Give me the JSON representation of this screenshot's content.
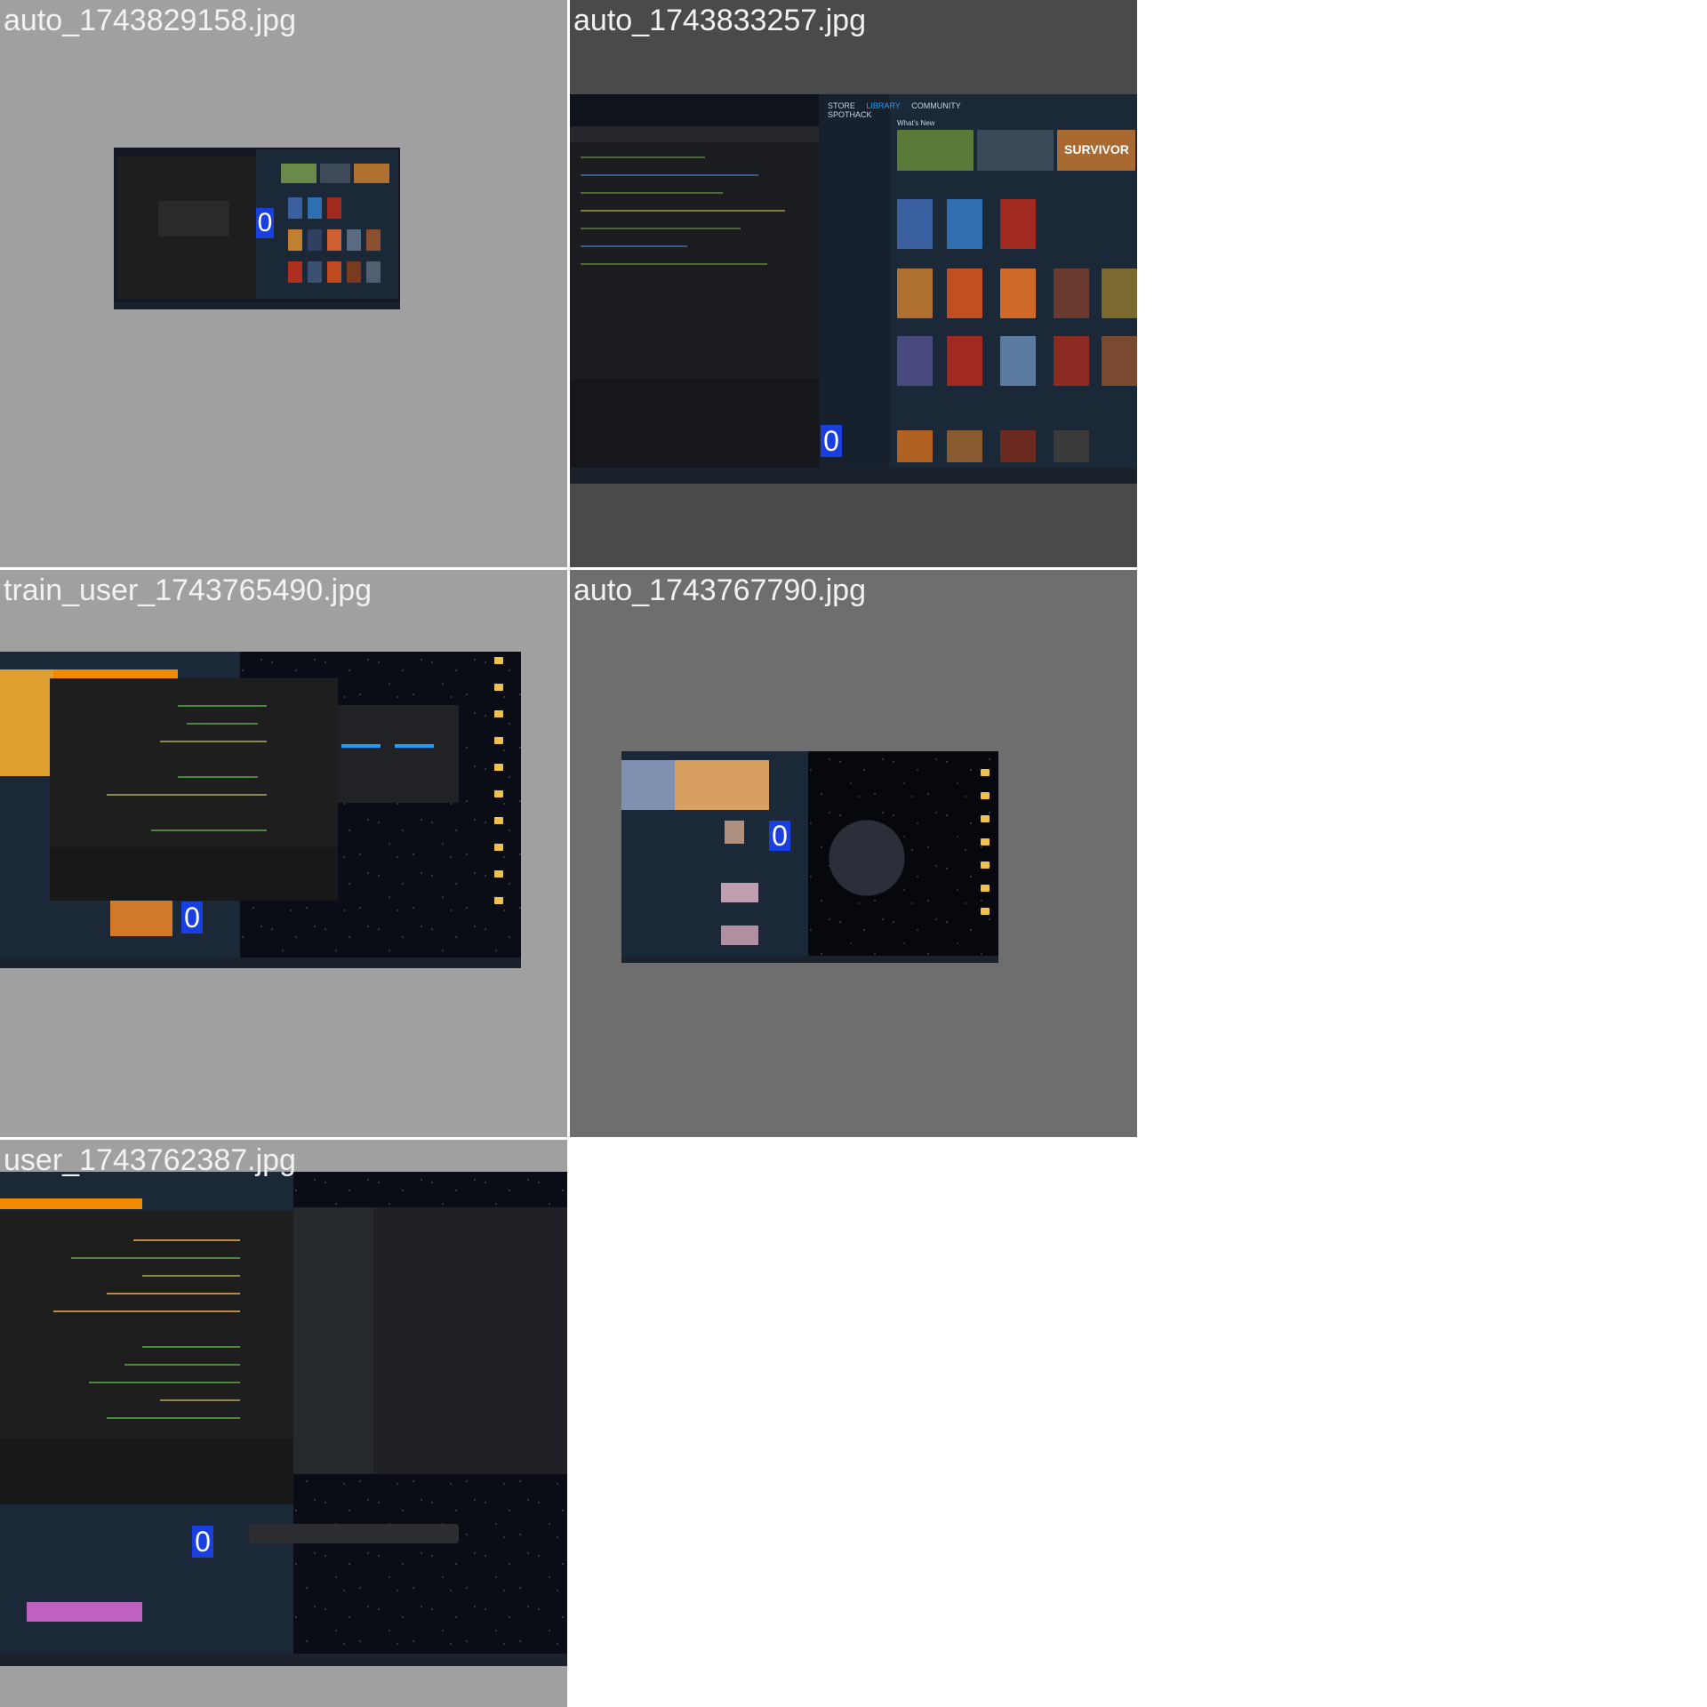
{
  "tiles": [
    {
      "filename": "auto_1743829158.jpg",
      "badge": "0",
      "background": "#a0a0a0"
    },
    {
      "filename": "auto_1743833257.jpg",
      "badge": "0",
      "background": "#4a4a4a"
    },
    {
      "filename": "train_user_1743765490.jpg",
      "badge": "0",
      "background": "#a0a0a0"
    },
    {
      "filename": "auto_1743767790.jpg",
      "badge": "0",
      "background": "#6e6e6e"
    },
    {
      "filename": "user_1743762387.jpg",
      "badge": "0",
      "background": "#a0a0a0"
    }
  ],
  "steam": {
    "nav": [
      "STORE",
      "LIBRARY",
      "COMMUNITY",
      "SPOTHACK"
    ],
    "whats_new": "What's New",
    "featured_title": "SURVIVOR"
  },
  "colors": {
    "badge": "#1a3fe0",
    "steam_bg": "#1b2838",
    "accent": "#1a9fff",
    "orange": "#f08a00"
  }
}
